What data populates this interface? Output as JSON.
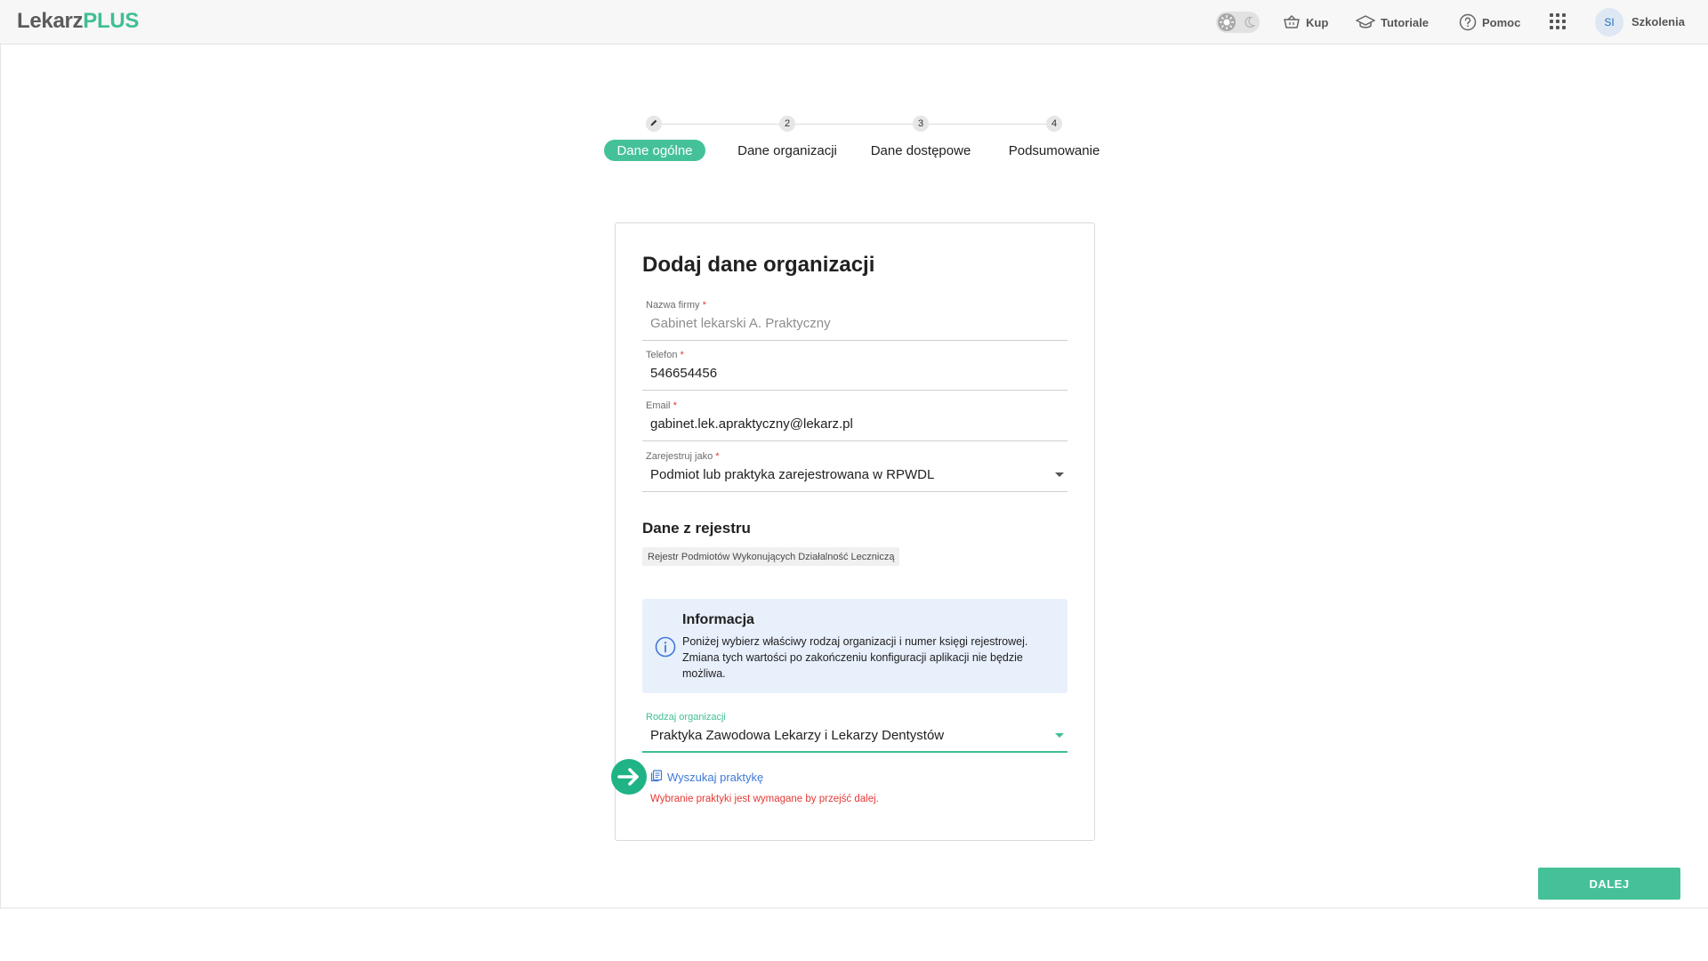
{
  "header": {
    "logo_part1": "Lekarz",
    "logo_part2": "PLUS",
    "nav": [
      {
        "label": "Kup",
        "icon": "basket-icon"
      },
      {
        "label": "Tutoriale",
        "icon": "graduation-cap-icon"
      },
      {
        "label": "Pomoc",
        "icon": "help-circle-icon"
      }
    ],
    "avatar_initials": "SI",
    "user_name": "Szkolenia"
  },
  "stepper": {
    "steps": [
      {
        "number": "",
        "label": "Dane ogólne",
        "state": "active",
        "icon": "pencil-icon"
      },
      {
        "number": "2",
        "label": "Dane organizacji",
        "state": "pending"
      },
      {
        "number": "3",
        "label": "Dane dostępowe",
        "state": "pending"
      },
      {
        "number": "4",
        "label": "Podsumowanie",
        "state": "pending"
      }
    ]
  },
  "form": {
    "title": "Dodaj dane organizacji",
    "fields": {
      "company": {
        "label": "Nazwa firmy",
        "required_mark": "*",
        "value": "Gabinet lekarski A. Praktyczny"
      },
      "phone": {
        "label": "Telefon",
        "required_mark": "*",
        "value": "546654456"
      },
      "email": {
        "label": "Email",
        "required_mark": "*",
        "value": "gabinet.lek.apraktyczny@lekarz.pl"
      },
      "register_as": {
        "label": "Zarejestruj jako",
        "required_mark": "*",
        "value": "Podmiot lub praktyka zarejestrowana w RPWDL"
      }
    },
    "registry": {
      "title": "Dane z rejestru",
      "chip": "Rejestr Podmiotów Wykonujących Działalność Leczniczą"
    },
    "info": {
      "title": "Informacja",
      "text": "Poniżej wybierz właściwy rodzaj organizacji i numer księgi rejestrowej. Zmiana tych wartości po zakończeniu konfiguracji aplikacji nie będzie możliwa."
    },
    "org_type": {
      "label": "Rodzaj organizacji",
      "value": "Praktyka Zawodowa Lekarzy i Lekarzy Dentystów"
    },
    "search_link": "Wyszukaj praktykę",
    "error": "Wybranie praktyki jest wymagane by przejść dalej."
  },
  "footer": {
    "next_label": "DALEJ"
  },
  "colors": {
    "accent": "#45c199",
    "logo_green": "#3fbf92",
    "link": "#3f7ad8",
    "error": "#e53935",
    "info_bg": "#e8f0fc"
  }
}
